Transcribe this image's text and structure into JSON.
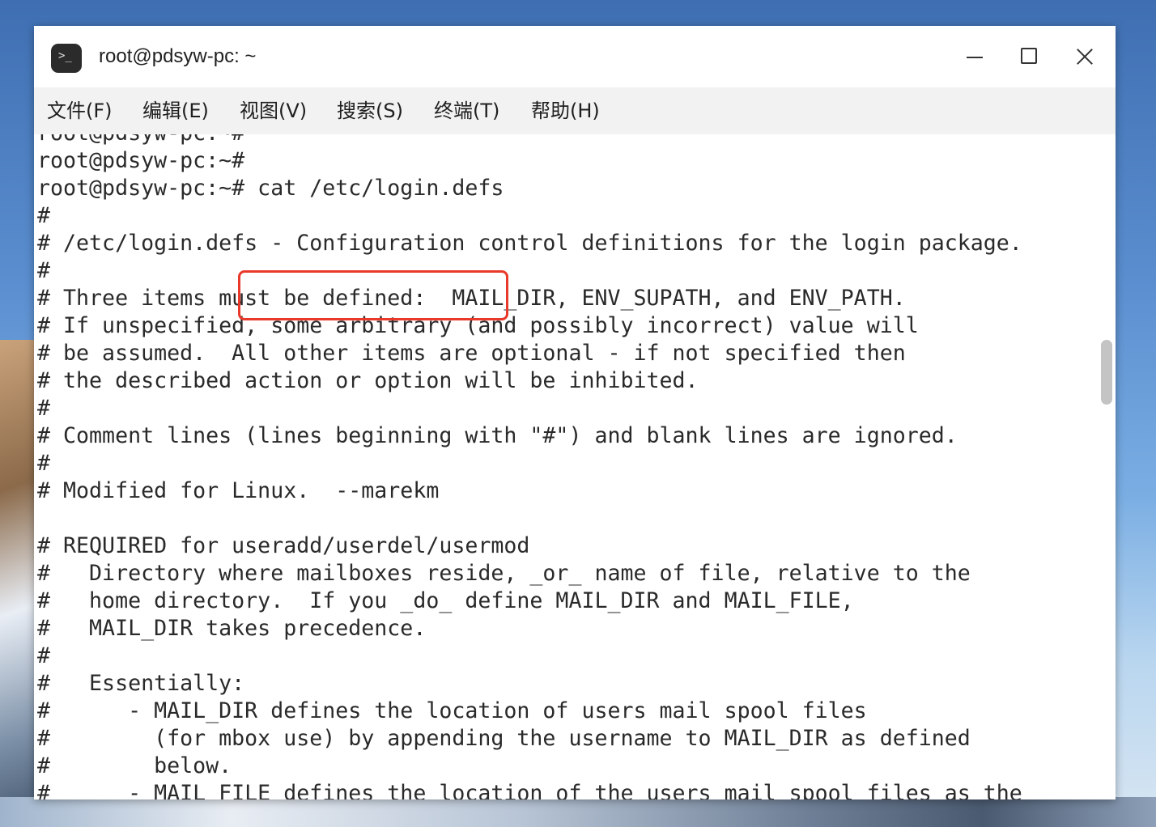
{
  "window": {
    "title": "root@pdsyw-pc: ~",
    "icon": "terminal-icon",
    "icon_prompt": ">_"
  },
  "menu": {
    "items": [
      {
        "label": "文件(F)"
      },
      {
        "label": "编辑(E)"
      },
      {
        "label": "视图(V)"
      },
      {
        "label": "搜索(S)"
      },
      {
        "label": "终端(T)"
      },
      {
        "label": "帮助(H)"
      }
    ]
  },
  "terminal": {
    "lines": [
      "root@pdsyw-pc:~#",
      "root@pdsyw-pc:~#",
      "root@pdsyw-pc:~# cat /etc/login.defs",
      "#",
      "# /etc/login.defs - Configuration control definitions for the login package.",
      "#",
      "# Three items must be defined:  MAIL_DIR, ENV_SUPATH, and ENV_PATH.",
      "# If unspecified, some arbitrary (and possibly incorrect) value will",
      "# be assumed.  All other items are optional - if not specified then",
      "# the described action or option will be inhibited.",
      "#",
      "# Comment lines (lines beginning with \"#\") and blank lines are ignored.",
      "#",
      "# Modified for Linux.  --marekm",
      "",
      "# REQUIRED for useradd/userdel/usermod",
      "#   Directory where mailboxes reside, _or_ name of file, relative to the",
      "#   home directory.  If you _do_ define MAIL_DIR and MAIL_FILE,",
      "#   MAIL_DIR takes precedence.",
      "#",
      "#   Essentially:",
      "#      - MAIL_DIR defines the location of users mail spool files",
      "#        (for mbox use) by appending the username to MAIL_DIR as defined",
      "#        below.",
      "#      - MAIL_FILE defines the location of the users mail spool files as the"
    ],
    "highlighted_command": "cat /etc/login.defs"
  },
  "colors": {
    "highlight_border": "#e8392a",
    "terminal_text": "#2a2a2a",
    "menubar_bg": "#f2f2f2"
  }
}
